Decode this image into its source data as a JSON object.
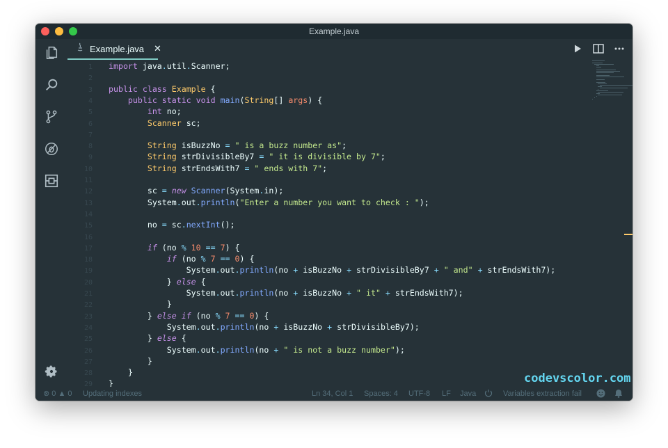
{
  "window": {
    "title": "Example.java"
  },
  "tab": {
    "label": "Example.java",
    "close": "✕"
  },
  "code_lines": [
    {
      "n": "1",
      "tokens": [
        [
          "kw",
          "import"
        ],
        [
          "pl",
          " java"
        ],
        [
          "op",
          "."
        ],
        [
          "pl",
          "util"
        ],
        [
          "op",
          "."
        ],
        [
          "pl",
          "Scanner;"
        ]
      ]
    },
    {
      "n": "2",
      "tokens": []
    },
    {
      "n": "3",
      "tokens": [
        [
          "kw",
          "public"
        ],
        [
          "kw",
          " class"
        ],
        [
          "cls",
          " Example"
        ],
        [
          "pl",
          " {"
        ]
      ]
    },
    {
      "n": "4",
      "tokens": [
        [
          "pl",
          "    "
        ],
        [
          "kw",
          "public"
        ],
        [
          "kw",
          " static"
        ],
        [
          "kw",
          " void"
        ],
        [
          "fn",
          " main"
        ],
        [
          "pl",
          "("
        ],
        [
          "cls",
          "String"
        ],
        [
          "pl",
          "[] "
        ],
        [
          "prm",
          "args"
        ],
        [
          "pl",
          ") {"
        ]
      ]
    },
    {
      "n": "5",
      "tokens": [
        [
          "pl",
          "        "
        ],
        [
          "kw",
          "int"
        ],
        [
          "pl",
          " no;"
        ]
      ]
    },
    {
      "n": "6",
      "tokens": [
        [
          "pl",
          "        "
        ],
        [
          "cls",
          "Scanner"
        ],
        [
          "pl",
          " sc;"
        ]
      ]
    },
    {
      "n": "7",
      "tokens": []
    },
    {
      "n": "8",
      "tokens": [
        [
          "pl",
          "        "
        ],
        [
          "cls",
          "String"
        ],
        [
          "pl",
          " isBuzzNo "
        ],
        [
          "op",
          "="
        ],
        [
          "str",
          " \" is a buzz number as\""
        ],
        [
          "pl",
          ";"
        ]
      ]
    },
    {
      "n": "9",
      "tokens": [
        [
          "pl",
          "        "
        ],
        [
          "cls",
          "String"
        ],
        [
          "pl",
          " strDivisibleBy7 "
        ],
        [
          "op",
          "="
        ],
        [
          "str",
          " \" it is divisible by 7\""
        ],
        [
          "pl",
          ";"
        ]
      ]
    },
    {
      "n": "10",
      "tokens": [
        [
          "pl",
          "        "
        ],
        [
          "cls",
          "String"
        ],
        [
          "pl",
          " strEndsWith7 "
        ],
        [
          "op",
          "="
        ],
        [
          "str",
          " \" ends with 7\""
        ],
        [
          "pl",
          ";"
        ]
      ]
    },
    {
      "n": "11",
      "tokens": []
    },
    {
      "n": "12",
      "tokens": [
        [
          "pl",
          "        sc "
        ],
        [
          "op",
          "="
        ],
        [
          "kwi",
          " new"
        ],
        [
          "fn",
          " Scanner"
        ],
        [
          "pl",
          "(System"
        ],
        [
          "op",
          "."
        ],
        [
          "pl",
          "in);"
        ]
      ]
    },
    {
      "n": "13",
      "tokens": [
        [
          "pl",
          "        System"
        ],
        [
          "op",
          "."
        ],
        [
          "pl",
          "out"
        ],
        [
          "op",
          "."
        ],
        [
          "fn",
          "println"
        ],
        [
          "pl",
          "("
        ],
        [
          "str",
          "\"Enter a number you want to check : \""
        ],
        [
          "pl",
          ");"
        ]
      ]
    },
    {
      "n": "14",
      "tokens": []
    },
    {
      "n": "15",
      "tokens": [
        [
          "pl",
          "        no "
        ],
        [
          "op",
          "="
        ],
        [
          "pl",
          " sc"
        ],
        [
          "op",
          "."
        ],
        [
          "fn",
          "nextInt"
        ],
        [
          "pl",
          "();"
        ]
      ]
    },
    {
      "n": "16",
      "tokens": []
    },
    {
      "n": "17",
      "tokens": [
        [
          "pl",
          "        "
        ],
        [
          "kwi",
          "if"
        ],
        [
          "pl",
          " (no "
        ],
        [
          "op",
          "%"
        ],
        [
          "num",
          " 10"
        ],
        [
          "op",
          " =="
        ],
        [
          "num",
          " 7"
        ],
        [
          "pl",
          ") {"
        ]
      ]
    },
    {
      "n": "18",
      "tokens": [
        [
          "pl",
          "            "
        ],
        [
          "kwi",
          "if"
        ],
        [
          "pl",
          " (no "
        ],
        [
          "op",
          "%"
        ],
        [
          "num",
          " 7"
        ],
        [
          "op",
          " =="
        ],
        [
          "num",
          " 0"
        ],
        [
          "pl",
          ") {"
        ]
      ]
    },
    {
      "n": "19",
      "tokens": [
        [
          "pl",
          "                System"
        ],
        [
          "op",
          "."
        ],
        [
          "pl",
          "out"
        ],
        [
          "op",
          "."
        ],
        [
          "fn",
          "println"
        ],
        [
          "pl",
          "(no "
        ],
        [
          "op",
          "+"
        ],
        [
          "pl",
          " isBuzzNo "
        ],
        [
          "op",
          "+"
        ],
        [
          "pl",
          " strDivisibleBy7 "
        ],
        [
          "op",
          "+"
        ],
        [
          "str",
          " \" and\""
        ],
        [
          "op",
          " +"
        ],
        [
          "pl",
          " strEndsWith7);"
        ]
      ]
    },
    {
      "n": "20",
      "tokens": [
        [
          "pl",
          "            } "
        ],
        [
          "kwi",
          "else"
        ],
        [
          "pl",
          " {"
        ]
      ]
    },
    {
      "n": "21",
      "tokens": [
        [
          "pl",
          "                System"
        ],
        [
          "op",
          "."
        ],
        [
          "pl",
          "out"
        ],
        [
          "op",
          "."
        ],
        [
          "fn",
          "println"
        ],
        [
          "pl",
          "(no "
        ],
        [
          "op",
          "+"
        ],
        [
          "pl",
          " isBuzzNo "
        ],
        [
          "op",
          "+"
        ],
        [
          "str",
          " \" it\""
        ],
        [
          "op",
          " +"
        ],
        [
          "pl",
          " strEndsWith7);"
        ]
      ]
    },
    {
      "n": "22",
      "tokens": [
        [
          "pl",
          "            }"
        ]
      ]
    },
    {
      "n": "23",
      "tokens": [
        [
          "pl",
          "        } "
        ],
        [
          "kwi",
          "else"
        ],
        [
          "kwi",
          " if"
        ],
        [
          "pl",
          " (no "
        ],
        [
          "op",
          "%"
        ],
        [
          "num",
          " 7"
        ],
        [
          "op",
          " =="
        ],
        [
          "num",
          " 0"
        ],
        [
          "pl",
          ") {"
        ]
      ]
    },
    {
      "n": "24",
      "tokens": [
        [
          "pl",
          "            System"
        ],
        [
          "op",
          "."
        ],
        [
          "pl",
          "out"
        ],
        [
          "op",
          "."
        ],
        [
          "fn",
          "println"
        ],
        [
          "pl",
          "(no "
        ],
        [
          "op",
          "+"
        ],
        [
          "pl",
          " isBuzzNo "
        ],
        [
          "op",
          "+"
        ],
        [
          "pl",
          " strDivisibleBy7);"
        ]
      ]
    },
    {
      "n": "25",
      "tokens": [
        [
          "pl",
          "        } "
        ],
        [
          "kwi",
          "else"
        ],
        [
          "pl",
          " {"
        ]
      ]
    },
    {
      "n": "26",
      "tokens": [
        [
          "pl",
          "            System"
        ],
        [
          "op",
          "."
        ],
        [
          "pl",
          "out"
        ],
        [
          "op",
          "."
        ],
        [
          "fn",
          "println"
        ],
        [
          "pl",
          "(no "
        ],
        [
          "op",
          "+"
        ],
        [
          "str",
          " \" is not a buzz number\""
        ],
        [
          "pl",
          ");"
        ]
      ]
    },
    {
      "n": "27",
      "tokens": [
        [
          "pl",
          "        }"
        ]
      ]
    },
    {
      "n": "28",
      "tokens": [
        [
          "pl",
          "    }"
        ]
      ]
    },
    {
      "n": "29",
      "tokens": [
        [
          "pl",
          "}"
        ]
      ]
    }
  ],
  "status": {
    "errors": "0",
    "warnings": "0",
    "task": "Updating indexes",
    "cursor": "Ln 34, Col 1",
    "spaces": "Spaces: 4",
    "encoding": "UTF-8",
    "eol": "LF",
    "language": "Java",
    "extraction": "Variables extraction fail"
  },
  "watermark": "codevscolor.com",
  "icons": {
    "activity": [
      "explorer-icon",
      "search-icon",
      "source-control-icon",
      "debug-icon",
      "extensions-icon",
      "settings-gear-icon"
    ],
    "tab_actions": [
      "run-icon",
      "split-editor-icon",
      "more-actions-icon"
    ]
  },
  "colors": {
    "background": "#263238",
    "accent": "#80cbc4",
    "keyword": "#c792ea",
    "type": "#ffcb6b",
    "function": "#82aaff",
    "string": "#c3e88d",
    "number": "#f78c6c",
    "operator": "#89ddff"
  }
}
